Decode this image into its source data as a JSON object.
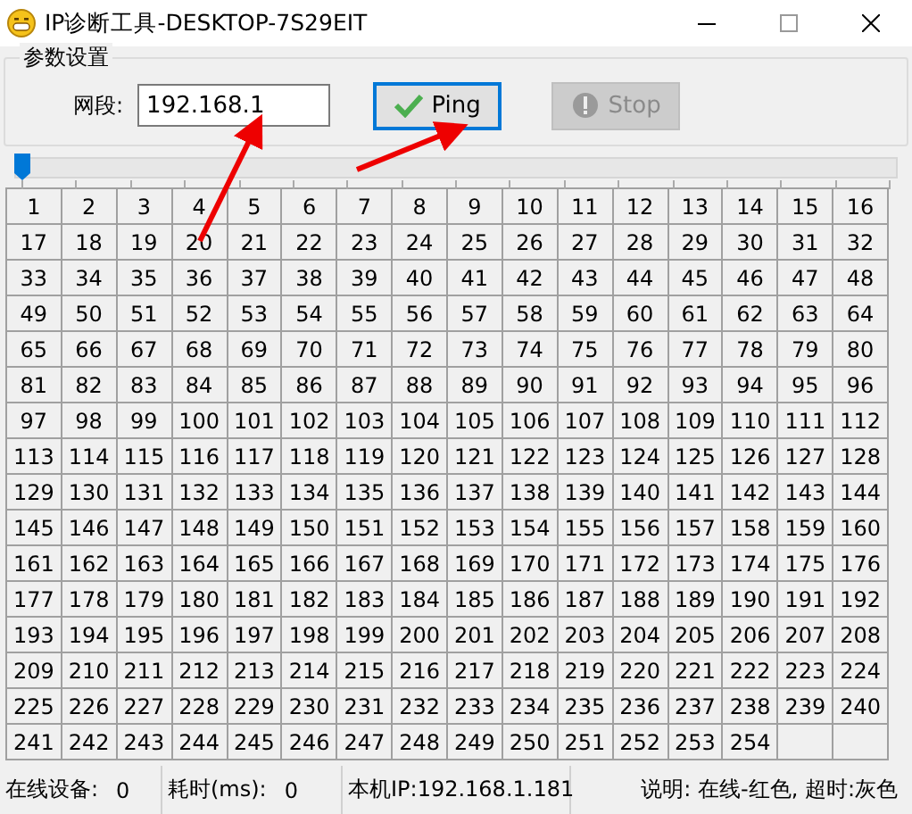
{
  "window": {
    "title": "IP诊断工具-DESKTOP-7S29EIT"
  },
  "settings": {
    "title": "参数设置",
    "segment_label": "网段:",
    "segment_value": "192.168.1",
    "buttons": [
      {
        "label": "Ping",
        "kind": "ping",
        "disabled": false,
        "focused": true
      },
      {
        "label": "Stop",
        "kind": "stop",
        "disabled": true,
        "focused": false
      }
    ]
  },
  "slider": {
    "level": 0
  },
  "grid": {
    "cells": [
      "1",
      "2",
      "3",
      "4",
      "5",
      "6",
      "7",
      "8",
      "9",
      "10",
      "11",
      "12",
      "13",
      "14",
      "15",
      "16",
      "17",
      "18",
      "19",
      "20",
      "21",
      "22",
      "23",
      "24",
      "25",
      "26",
      "27",
      "28",
      "29",
      "30",
      "31",
      "32",
      "33",
      "34",
      "35",
      "36",
      "37",
      "38",
      "39",
      "40",
      "41",
      "42",
      "43",
      "44",
      "45",
      "46",
      "47",
      "48",
      "49",
      "50",
      "51",
      "52",
      "53",
      "54",
      "55",
      "56",
      "57",
      "58",
      "59",
      "60",
      "61",
      "62",
      "63",
      "64",
      "65",
      "66",
      "67",
      "68",
      "69",
      "70",
      "71",
      "72",
      "73",
      "74",
      "75",
      "76",
      "77",
      "78",
      "79",
      "80",
      "81",
      "82",
      "83",
      "84",
      "85",
      "86",
      "87",
      "88",
      "89",
      "90",
      "91",
      "92",
      "93",
      "94",
      "95",
      "96",
      "97",
      "98",
      "99",
      "100",
      "101",
      "102",
      "103",
      "104",
      "105",
      "106",
      "107",
      "108",
      "109",
      "110",
      "111",
      "112",
      "113",
      "114",
      "115",
      "116",
      "117",
      "118",
      "119",
      "120",
      "121",
      "122",
      "123",
      "124",
      "125",
      "126",
      "127",
      "128",
      "129",
      "130",
      "131",
      "132",
      "133",
      "134",
      "135",
      "136",
      "137",
      "138",
      "139",
      "140",
      "141",
      "142",
      "143",
      "144",
      "145",
      "146",
      "147",
      "148",
      "149",
      "150",
      "151",
      "152",
      "153",
      "154",
      "155",
      "156",
      "157",
      "158",
      "159",
      "160",
      "161",
      "162",
      "163",
      "164",
      "165",
      "166",
      "167",
      "168",
      "169",
      "170",
      "171",
      "172",
      "173",
      "174",
      "175",
      "176",
      "177",
      "178",
      "179",
      "180",
      "181",
      "182",
      "183",
      "184",
      "185",
      "186",
      "187",
      "188",
      "189",
      "190",
      "191",
      "192",
      "193",
      "194",
      "195",
      "196",
      "197",
      "198",
      "199",
      "200",
      "201",
      "202",
      "203",
      "204",
      "205",
      "206",
      "207",
      "208",
      "209",
      "210",
      "211",
      "212",
      "213",
      "214",
      "215",
      "216",
      "217",
      "218",
      "219",
      "220",
      "221",
      "222",
      "223",
      "224",
      "225",
      "226",
      "227",
      "228",
      "229",
      "230",
      "231",
      "232",
      "233",
      "234",
      "235",
      "236",
      "237",
      "238",
      "239",
      "240",
      "241",
      "242",
      "243",
      "244",
      "245",
      "246",
      "247",
      "248",
      "249",
      "250",
      "251",
      "252",
      "253",
      "254"
    ]
  },
  "status_bar": [
    {
      "label": "在线设备:",
      "value": "0"
    },
    {
      "label": "耗时(ms):",
      "value": "0"
    },
    {
      "label": "本机IP:192.168.1.181"
    },
    {
      "label": "说明: 在线-红色, 超时:灰色"
    }
  ]
}
